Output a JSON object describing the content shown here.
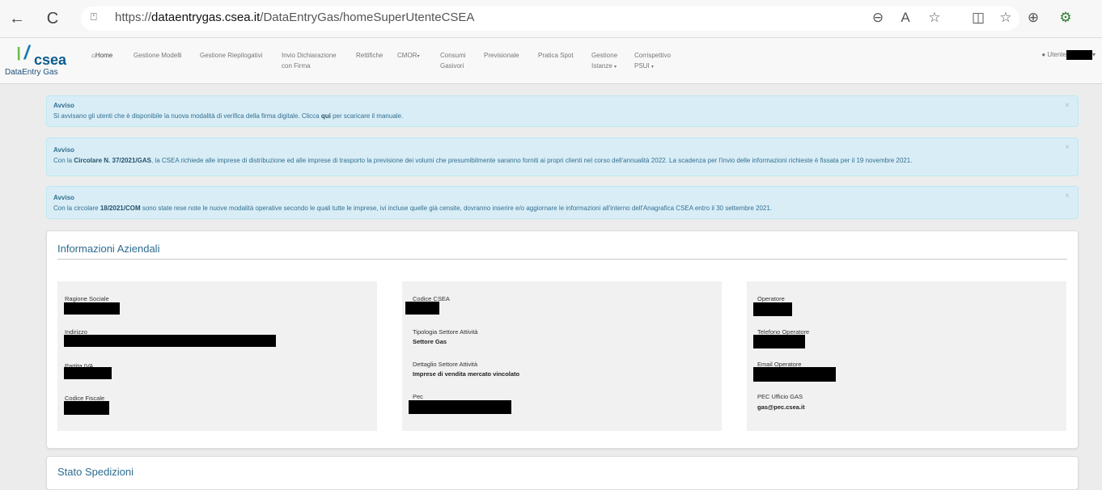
{
  "browser": {
    "url_prefix": "https://",
    "url_host": "dataentrygas.csea.it",
    "url_path": "/DataEntryGas/homeSuperUtenteCSEA",
    "back": "←",
    "reload": "C",
    "site_info": "⍞",
    "toolbar_icons": [
      "⊖",
      "A",
      "☆",
      "◫",
      "☆",
      "⊕",
      "⚙"
    ]
  },
  "logo": {
    "word": "csea",
    "sub": "DataEntry Gas"
  },
  "nav": {
    "home": "Home",
    "items": [
      "Gestione Modelli",
      "Gestione Riepilogativi",
      "Invio Dichiarazione",
      "con Firma",
      "Rettifiche",
      "CMOR",
      "Consumi",
      "Gasivori",
      "Previsionale",
      "Pratica Spot",
      "Gestione",
      "Istanze",
      "Corrispettivo",
      "PSUI"
    ],
    "user": "Utente"
  },
  "alerts": [
    {
      "title": "Avviso",
      "text_before": "Si avvisano gli utenti che è disponibile la nuova modalità di verifica della firma digitale. Clicca ",
      "link": "qui",
      "text_after": " per scaricare il manuale."
    },
    {
      "title": "Avviso",
      "text_before": "Con la ",
      "link": "Circolare N. 37/2021/GAS",
      "text_after": ", la CSEA richiede alle imprese di distribuzione ed alle imprese di trasporto la previsione dei volumi che presumibilmente saranno forniti ai propri clienti nel corso dell'annualità 2022. La scadenza per l'invio delle informazioni richieste è fissata per il 19 novembre 2021."
    },
    {
      "title": "Avviso",
      "text_before": "Con la circolare ",
      "link": "18/2021/COM",
      "text_after": " sono state rese note le nuove modalità operative secondo le quali tutte le imprese, ivi incluse quelle già censite, dovranno inserire e/o aggiornare le informazioni all'interno dell'Anagrafica CSEA entro il 30 settembre 2021."
    }
  ],
  "close_symbol": "×",
  "info": {
    "title": "Informazioni Aziendali",
    "col1": {
      "ragione_sociale": "Ragione Sociale",
      "indirizzo": "Indirizzo",
      "partita_iva": "Partita IVA",
      "codice_fiscale": "Codice Fiscale"
    },
    "col2": {
      "codice_csea": "Codice CSEA",
      "tipologia_label": "Tipologia Settore Attività",
      "tipologia_value": "Settore Gas",
      "dettaglio_label": "Dettaglio Settore Attività",
      "dettaglio_value": "Imprese di vendita mercato vincolato",
      "pec": "Pec"
    },
    "col3": {
      "operatore": "Operatore",
      "telefono": "Telefono Operatore",
      "email": "Email Operatore",
      "pec_ufficio_label": "PEC Ufficio GAS",
      "pec_ufficio_value": "gas@pec.csea.it"
    }
  },
  "stato": {
    "title": "Stato Spedizioni"
  }
}
